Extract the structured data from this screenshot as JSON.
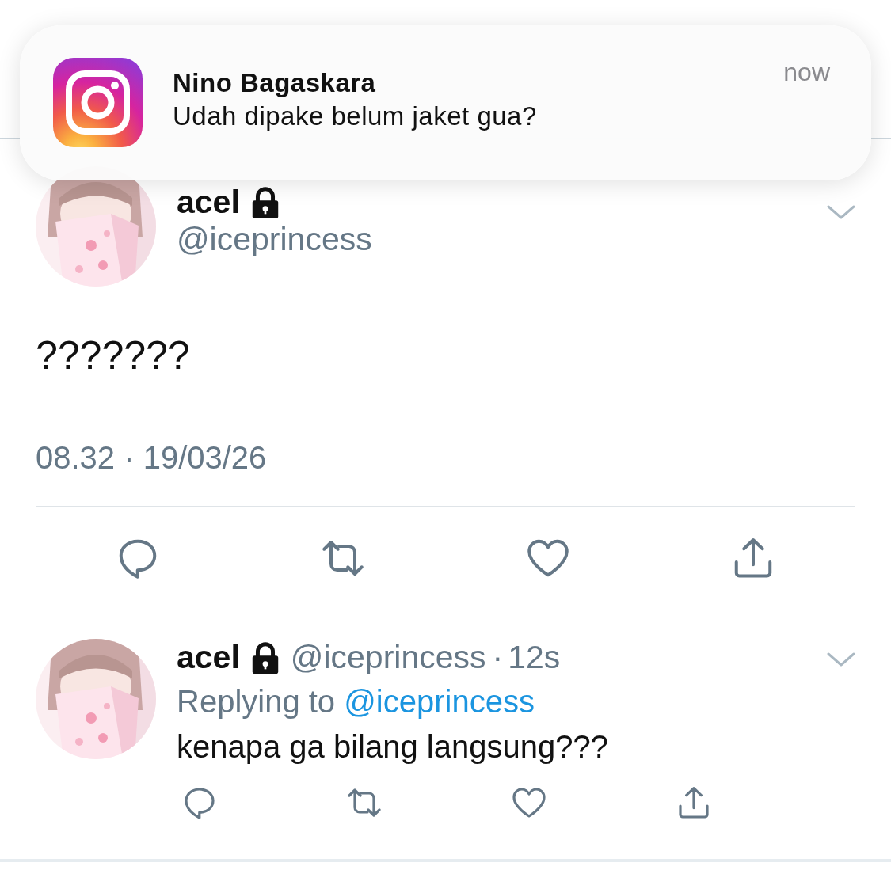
{
  "notification": {
    "title": "Nino Bagaskara",
    "message": "Udah dipake belum jaket gua?",
    "time": "now"
  },
  "tweet": {
    "name": "acel",
    "locked": true,
    "handle": "@iceprincess",
    "text": "???????",
    "timestamp": "08.32 · 19/03/26",
    "actions": [
      {
        "kind": "reply"
      },
      {
        "kind": "retweet"
      },
      {
        "kind": "like"
      },
      {
        "kind": "share"
      }
    ]
  },
  "replies": [
    {
      "name": "acel",
      "locked": true,
      "handle": "@iceprincess",
      "separator": "·",
      "time": "12s",
      "replying_label": "Replying to",
      "replying_to": "@iceprincess",
      "text": "kenapa ga bilang langsung???",
      "actions": [
        {
          "kind": "reply"
        },
        {
          "kind": "retweet"
        },
        {
          "kind": "like"
        },
        {
          "kind": "share"
        }
      ]
    }
  ]
}
